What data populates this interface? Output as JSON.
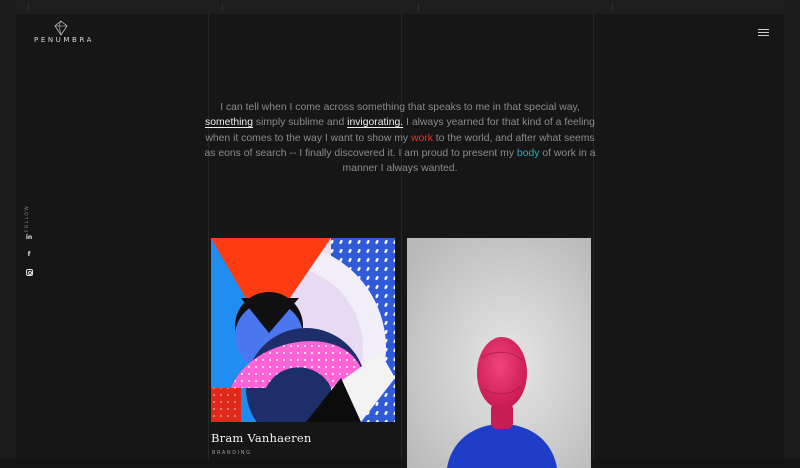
{
  "brand": {
    "name": "PENUMBRA",
    "icon": "diamond-logo-icon"
  },
  "header": {
    "menu_icon": "hamburger-menu-icon"
  },
  "social": {
    "follow_label": "FOLLOW",
    "linkedin": "in",
    "facebook": "f",
    "instagram_icon": "instagram-icon"
  },
  "intro": {
    "p1": "I can tell when I come across something that speaks to me in that special way,",
    "link1": "something",
    "p2": " simply sublime and ",
    "link2": "invigorating.",
    "p3": " I always yearned for that kind of a feeling when it comes to the way I want to show my ",
    "red_word": "work",
    "p4": " to the world, and after what seems as eons of search -- I finally discovered it. I am proud to present my ",
    "teal_word": "body",
    "p5": " of work in a manner I always wanted.",
    "colors": {
      "red": "#e4352a",
      "teal": "#1eb3c9"
    }
  },
  "portfolio": {
    "items": [
      {
        "title": "Bram Vanhaeren",
        "category": "BRANDING",
        "image": "abstract-geometric-artwork"
      },
      {
        "title": "",
        "category": "",
        "image": "pink-masked-figure-photo"
      }
    ]
  }
}
